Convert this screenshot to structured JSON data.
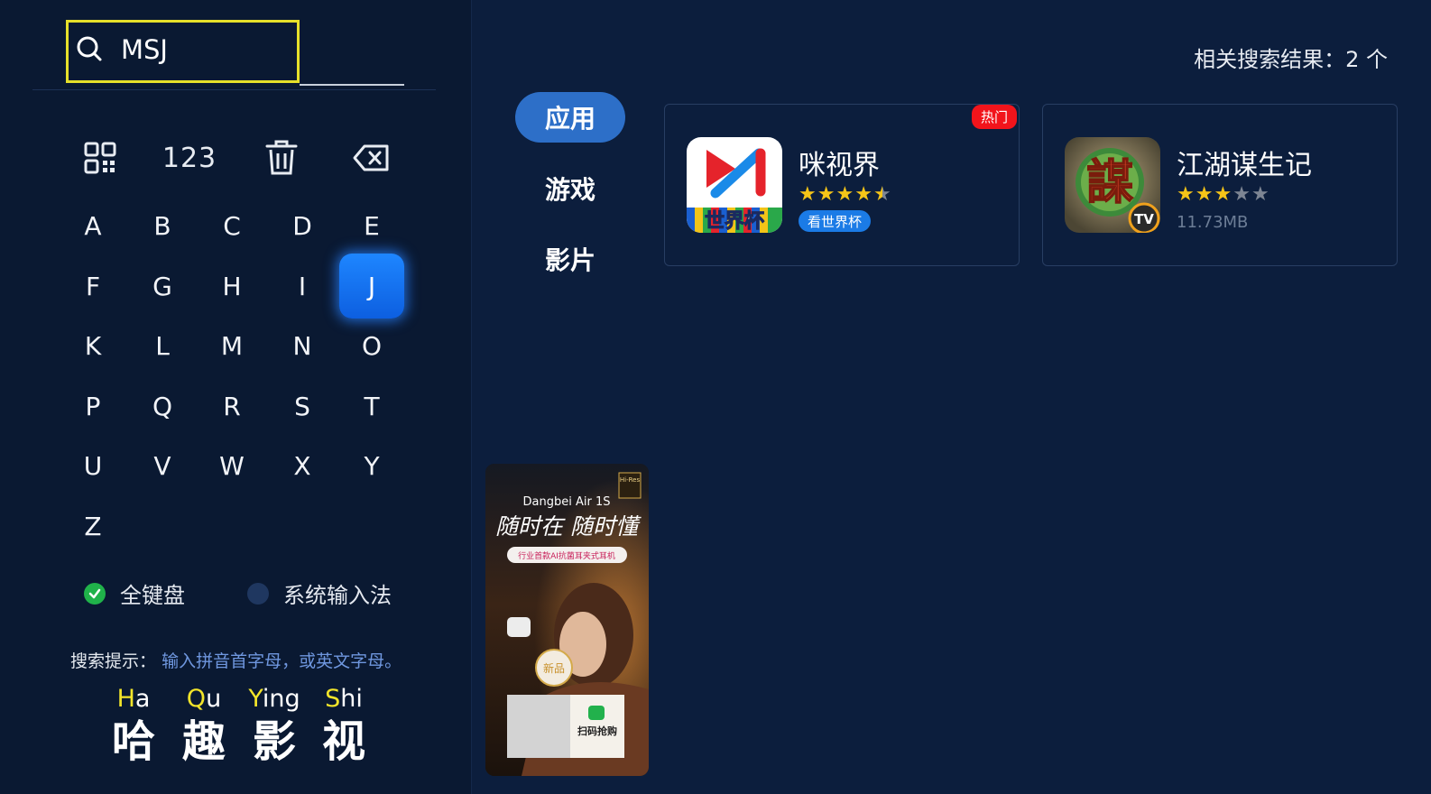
{
  "search": {
    "query": "MSJ"
  },
  "toolbar": {
    "numbers_label": "123"
  },
  "keyboard": {
    "focused_key": "J",
    "rows": [
      [
        "A",
        "B",
        "C",
        "D",
        "E"
      ],
      [
        "F",
        "G",
        "H",
        "I",
        "J"
      ],
      [
        "K",
        "L",
        "M",
        "N",
        "O"
      ],
      [
        "P",
        "Q",
        "R",
        "S",
        "T"
      ],
      [
        "U",
        "V",
        "W",
        "X",
        "Y"
      ],
      [
        "Z"
      ]
    ]
  },
  "input_modes": [
    {
      "label": "全键盘",
      "selected": true
    },
    {
      "label": "系统输入法",
      "selected": false
    }
  ],
  "hint": {
    "label": "搜索提示：",
    "text": "输入拼音首字母，或英文字母。"
  },
  "brand": [
    {
      "initial": "H",
      "rest": "a",
      "char": "哈"
    },
    {
      "initial": "Q",
      "rest": "u",
      "char": "趣"
    },
    {
      "initial": "Y",
      "rest": "ing",
      "char": "影"
    },
    {
      "initial": "S",
      "rest": "hi",
      "char": "视"
    }
  ],
  "results": {
    "count_label": "相关搜索结果：2 个"
  },
  "categories": [
    {
      "label": "应用",
      "active": true
    },
    {
      "label": "游戏",
      "active": false
    },
    {
      "label": "影片",
      "active": false
    }
  ],
  "apps": [
    {
      "name": "咪视界",
      "rating": 4.5,
      "badge": "热门",
      "tag": "看世界杯",
      "icon_text": "世界杯"
    },
    {
      "name": "江湖谋生记",
      "rating": 3,
      "size": "11.73MB",
      "icon_text": "謀"
    }
  ],
  "ad": {
    "brand": "Dangbei Air 1S",
    "headline": "随时在 随时懂",
    "subline": "行业首款AI抗菌耳夹式耳机",
    "new_badge": "新品",
    "qr_label": "扫码抢购",
    "hires_label": "Hi-Res"
  },
  "colors": {
    "accent_yellow": "#e6e02a",
    "focus_blue": "#1e86ff",
    "hot_red": "#f2141b",
    "star_gold": "#f5c518"
  }
}
